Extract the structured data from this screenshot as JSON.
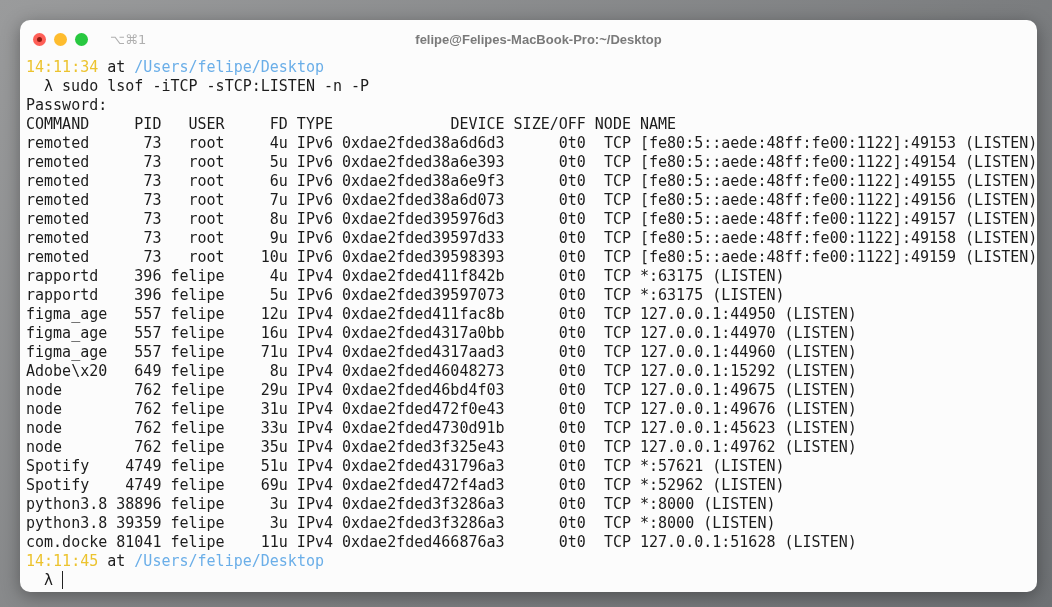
{
  "window": {
    "title": "felipe@Felipes-MacBook-Pro:~/Desktop",
    "shortcut": "⌥⌘1"
  },
  "first_prompt": {
    "time": "14:11:34",
    "at": "at",
    "path": "/Users/felipe/Desktop"
  },
  "command_line": {
    "symbol": "λ",
    "command": "sudo lsof -iTCP -sTCP:LISTEN -n -P"
  },
  "output_line": "Password:",
  "table": {
    "columns": [
      "COMMAND",
      "PID",
      "USER",
      "FD",
      "TYPE",
      "DEVICE",
      "SIZE/OFF",
      "NODE",
      "NAME"
    ],
    "rows": [
      [
        "remoted",
        "73",
        "root",
        "4u",
        "IPv6",
        "0xdae2fded38a6d6d3",
        "0t0",
        "TCP",
        "[fe80:5::aede:48ff:fe00:1122]:49153 (LISTEN)"
      ],
      [
        "remoted",
        "73",
        "root",
        "5u",
        "IPv6",
        "0xdae2fded38a6e393",
        "0t0",
        "TCP",
        "[fe80:5::aede:48ff:fe00:1122]:49154 (LISTEN)"
      ],
      [
        "remoted",
        "73",
        "root",
        "6u",
        "IPv6",
        "0xdae2fded38a6e9f3",
        "0t0",
        "TCP",
        "[fe80:5::aede:48ff:fe00:1122]:49155 (LISTEN)"
      ],
      [
        "remoted",
        "73",
        "root",
        "7u",
        "IPv6",
        "0xdae2fded38a6d073",
        "0t0",
        "TCP",
        "[fe80:5::aede:48ff:fe00:1122]:49156 (LISTEN)"
      ],
      [
        "remoted",
        "73",
        "root",
        "8u",
        "IPv6",
        "0xdae2fded395976d3",
        "0t0",
        "TCP",
        "[fe80:5::aede:48ff:fe00:1122]:49157 (LISTEN)"
      ],
      [
        "remoted",
        "73",
        "root",
        "9u",
        "IPv6",
        "0xdae2fded39597d33",
        "0t0",
        "TCP",
        "[fe80:5::aede:48ff:fe00:1122]:49158 (LISTEN)"
      ],
      [
        "remoted",
        "73",
        "root",
        "10u",
        "IPv6",
        "0xdae2fded39598393",
        "0t0",
        "TCP",
        "[fe80:5::aede:48ff:fe00:1122]:49159 (LISTEN)"
      ],
      [
        "rapportd",
        "396",
        "felipe",
        "4u",
        "IPv4",
        "0xdae2fded411f842b",
        "0t0",
        "TCP",
        "*:63175 (LISTEN)"
      ],
      [
        "rapportd",
        "396",
        "felipe",
        "5u",
        "IPv6",
        "0xdae2fded39597073",
        "0t0",
        "TCP",
        "*:63175 (LISTEN)"
      ],
      [
        "figma_age",
        "557",
        "felipe",
        "12u",
        "IPv4",
        "0xdae2fded411fac8b",
        "0t0",
        "TCP",
        "127.0.0.1:44950 (LISTEN)"
      ],
      [
        "figma_age",
        "557",
        "felipe",
        "16u",
        "IPv4",
        "0xdae2fded4317a0bb",
        "0t0",
        "TCP",
        "127.0.0.1:44970 (LISTEN)"
      ],
      [
        "figma_age",
        "557",
        "felipe",
        "71u",
        "IPv4",
        "0xdae2fded4317aad3",
        "0t0",
        "TCP",
        "127.0.0.1:44960 (LISTEN)"
      ],
      [
        "Adobe\\x20",
        "649",
        "felipe",
        "8u",
        "IPv4",
        "0xdae2fded46048273",
        "0t0",
        "TCP",
        "127.0.0.1:15292 (LISTEN)"
      ],
      [
        "node",
        "762",
        "felipe",
        "29u",
        "IPv4",
        "0xdae2fded46bd4f03",
        "0t0",
        "TCP",
        "127.0.0.1:49675 (LISTEN)"
      ],
      [
        "node",
        "762",
        "felipe",
        "31u",
        "IPv4",
        "0xdae2fded472f0e43",
        "0t0",
        "TCP",
        "127.0.0.1:49676 (LISTEN)"
      ],
      [
        "node",
        "762",
        "felipe",
        "33u",
        "IPv4",
        "0xdae2fded4730d91b",
        "0t0",
        "TCP",
        "127.0.0.1:45623 (LISTEN)"
      ],
      [
        "node",
        "762",
        "felipe",
        "35u",
        "IPv4",
        "0xdae2fded3f325e43",
        "0t0",
        "TCP",
        "127.0.0.1:49762 (LISTEN)"
      ],
      [
        "Spotify",
        "4749",
        "felipe",
        "51u",
        "IPv4",
        "0xdae2fded431796a3",
        "0t0",
        "TCP",
        "*:57621 (LISTEN)"
      ],
      [
        "Spotify",
        "4749",
        "felipe",
        "69u",
        "IPv4",
        "0xdae2fded472f4ad3",
        "0t0",
        "TCP",
        "*:52962 (LISTEN)"
      ],
      [
        "python3.8",
        "38896",
        "felipe",
        "3u",
        "IPv4",
        "0xdae2fded3f3286a3",
        "0t0",
        "TCP",
        "*:8000 (LISTEN)"
      ],
      [
        "python3.8",
        "39359",
        "felipe",
        "3u",
        "IPv4",
        "0xdae2fded3f3286a3",
        "0t0",
        "TCP",
        "*:8000 (LISTEN)"
      ],
      [
        "com.docke",
        "81041",
        "felipe",
        "11u",
        "IPv4",
        "0xdae2fded466876a3",
        "0t0",
        "TCP",
        "127.0.0.1:51628 (LISTEN)"
      ]
    ]
  },
  "second_prompt": {
    "time": "14:11:45",
    "at": "at",
    "path": "/Users/felipe/Desktop"
  },
  "input_line": {
    "symbol": "λ"
  }
}
